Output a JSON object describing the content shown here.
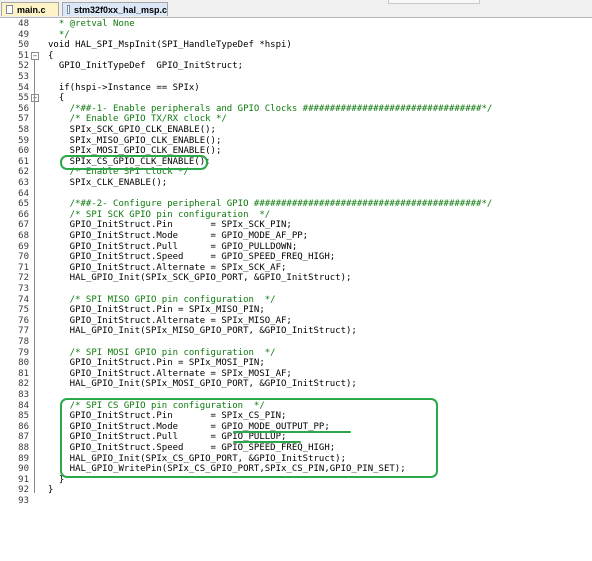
{
  "tabs": [
    {
      "label": "main.c"
    },
    {
      "label": "stm32f0xx_hal_msp.c"
    }
  ],
  "lines": [
    {
      "num": "48",
      "text": "  * @retval None",
      "kind": "comment"
    },
    {
      "num": "49",
      "text": "  */",
      "kind": "comment"
    },
    {
      "num": "50",
      "text": "void HAL_SPI_MspInit(SPI_HandleTypeDef *hspi)",
      "kind": "code"
    },
    {
      "num": "51",
      "text": "{",
      "kind": "code",
      "fold": "-"
    },
    {
      "num": "52",
      "text": "  GPIO_InitTypeDef  GPIO_InitStruct;",
      "kind": "code"
    },
    {
      "num": "53",
      "text": "",
      "kind": "code"
    },
    {
      "num": "54",
      "text": "  if(hspi->Instance == SPIx)",
      "kind": "code"
    },
    {
      "num": "55",
      "text": "  {",
      "kind": "code",
      "fold": "-"
    },
    {
      "num": "56",
      "text": "    /*##-1- Enable peripherals and GPIO Clocks #################################*/",
      "kind": "comment"
    },
    {
      "num": "57",
      "text": "    /* Enable GPIO TX/RX clock */",
      "kind": "comment"
    },
    {
      "num": "58",
      "text": "    SPIx_SCK_GPIO_CLK_ENABLE();",
      "kind": "code"
    },
    {
      "num": "59",
      "text": "    SPIx_MISO_GPIO_CLK_ENABLE();",
      "kind": "code"
    },
    {
      "num": "60",
      "text": "    SPIx_MOSI_GPIO_CLK_ENABLE();",
      "kind": "code"
    },
    {
      "num": "61",
      "text": "    SPIx_CS_GPIO_CLK_ENABLE();",
      "kind": "code"
    },
    {
      "num": "62",
      "text": "    /* Enable SPI clock */",
      "kind": "comment"
    },
    {
      "num": "63",
      "text": "    SPIx_CLK_ENABLE();",
      "kind": "code"
    },
    {
      "num": "64",
      "text": "",
      "kind": "code"
    },
    {
      "num": "65",
      "text": "    /*##-2- Configure peripheral GPIO ##########################################*/",
      "kind": "comment"
    },
    {
      "num": "66",
      "text": "    /* SPI SCK GPIO pin configuration  */",
      "kind": "comment"
    },
    {
      "num": "67",
      "text": "    GPIO_InitStruct.Pin       = SPIx_SCK_PIN;",
      "kind": "code"
    },
    {
      "num": "68",
      "text": "    GPIO_InitStruct.Mode      = GPIO_MODE_AF_PP;",
      "kind": "code"
    },
    {
      "num": "69",
      "text": "    GPIO_InitStruct.Pull      = GPIO_PULLDOWN;",
      "kind": "code"
    },
    {
      "num": "70",
      "text": "    GPIO_InitStruct.Speed     = GPIO_SPEED_FREQ_HIGH;",
      "kind": "code"
    },
    {
      "num": "71",
      "text": "    GPIO_InitStruct.Alternate = SPIx_SCK_AF;",
      "kind": "code"
    },
    {
      "num": "72",
      "text": "    HAL_GPIO_Init(SPIx_SCK_GPIO_PORT, &GPIO_InitStruct);",
      "kind": "code"
    },
    {
      "num": "73",
      "text": "",
      "kind": "code"
    },
    {
      "num": "74",
      "text": "    /* SPI MISO GPIO pin configuration  */",
      "kind": "comment"
    },
    {
      "num": "75",
      "text": "    GPIO_InitStruct.Pin = SPIx_MISO_PIN;",
      "kind": "code"
    },
    {
      "num": "76",
      "text": "    GPIO_InitStruct.Alternate = SPIx_MISO_AF;",
      "kind": "code"
    },
    {
      "num": "77",
      "text": "    HAL_GPIO_Init(SPIx_MISO_GPIO_PORT, &GPIO_InitStruct);",
      "kind": "code"
    },
    {
      "num": "78",
      "text": "",
      "kind": "code"
    },
    {
      "num": "79",
      "text": "    /* SPI MOSI GPIO pin configuration  */",
      "kind": "comment"
    },
    {
      "num": "80",
      "text": "    GPIO_InitStruct.Pin = SPIx_MOSI_PIN;",
      "kind": "code"
    },
    {
      "num": "81",
      "text": "    GPIO_InitStruct.Alternate = SPIx_MOSI_AF;",
      "kind": "code"
    },
    {
      "num": "82",
      "text": "    HAL_GPIO_Init(SPIx_MOSI_GPIO_PORT, &GPIO_InitStruct);",
      "kind": "code"
    },
    {
      "num": "83",
      "text": "",
      "kind": "code"
    },
    {
      "num": "84",
      "text": "    /* SPI CS GPIO pin configuration  */",
      "kind": "comment"
    },
    {
      "num": "85",
      "text": "    GPIO_InitStruct.Pin       = SPIx_CS_PIN;",
      "kind": "code"
    },
    {
      "num": "86",
      "text": "    GPIO_InitStruct.Mode      = GPIO_MODE_OUTPUT_PP;",
      "kind": "code"
    },
    {
      "num": "87",
      "text": "    GPIO_InitStruct.Pull      = GPIO_PULLUP;",
      "kind": "code"
    },
    {
      "num": "88",
      "text": "    GPIO_InitStruct.Speed     = GPIO_SPEED_FREQ_HIGH;",
      "kind": "code"
    },
    {
      "num": "89",
      "text": "    HAL_GPIO_Init(SPIx_CS_GPIO_PORT, &GPIO_InitStruct);",
      "kind": "code"
    },
    {
      "num": "90",
      "text": "    HAL_GPIO_WritePin(SPIx_CS_GPIO_PORT,SPIx_CS_PIN,GPIO_PIN_SET);",
      "kind": "code"
    },
    {
      "num": "91",
      "text": "  }",
      "kind": "code"
    },
    {
      "num": "92",
      "text": "}",
      "kind": "code"
    },
    {
      "num": "93",
      "text": "",
      "kind": "code"
    }
  ],
  "highlights": {
    "color": "#2aa84a",
    "boxes": [
      "line-61",
      "lines-84-90"
    ],
    "underlines": [
      "GPIO_MODE_OUTPUT_PP",
      "GPIO_PULLUP"
    ]
  },
  "colors": {
    "comment": "#0e7a0e",
    "code": "#000000",
    "line_number": "#3a3a3a"
  }
}
